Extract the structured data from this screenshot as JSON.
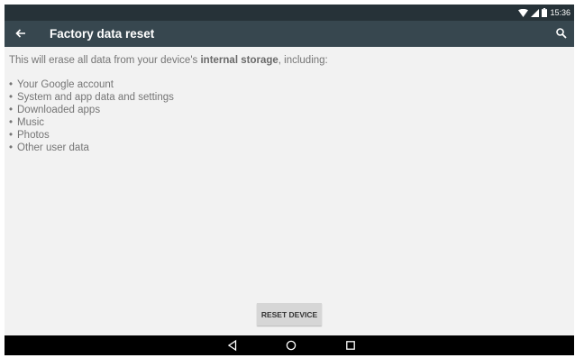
{
  "status_bar": {
    "time": "15:36"
  },
  "toolbar": {
    "title": "Factory data reset"
  },
  "content": {
    "intro_before": "This will erase all data from your device's ",
    "intro_bold": "internal storage",
    "intro_after": ", including:",
    "items": [
      "Your Google account",
      "System and app data and settings",
      "Downloaded apps",
      "Music",
      "Photos",
      "Other user data"
    ]
  },
  "actions": {
    "reset_label": "RESET DEVICE"
  },
  "icons": {
    "back": "arrow-back-icon",
    "search": "search-icon",
    "wifi": "wifi-icon",
    "signal": "cell-signal-icon",
    "battery": "battery-icon",
    "nav_back": "triangle-back-icon",
    "nav_home": "circle-home-icon",
    "nav_recents": "square-recents-icon"
  },
  "colors": {
    "status_bar": "#263238",
    "toolbar": "#37474f",
    "background": "#f2f2f2",
    "button": "#d6d6d6",
    "nav_bar": "#000000"
  }
}
